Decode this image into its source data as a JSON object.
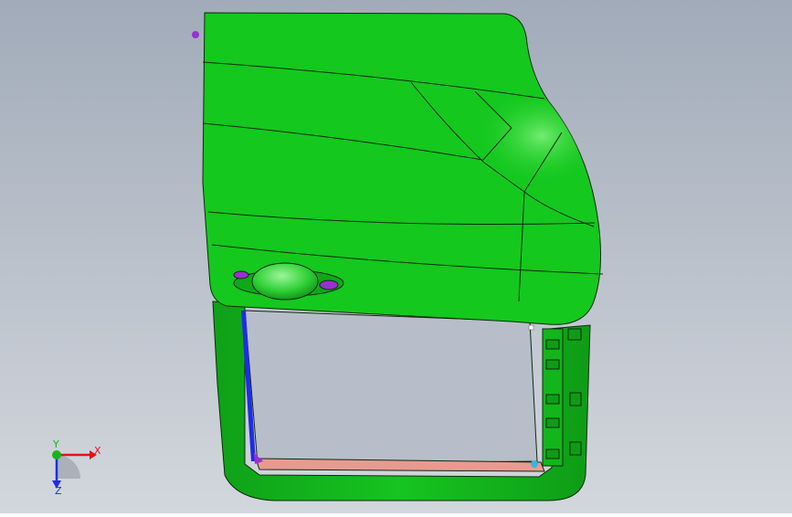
{
  "viewport": {
    "background_top": "#a1abb9",
    "background_bottom": "#d2d6dc",
    "part_color": "#14c81e",
    "part_edge_color": "#0d2a0d",
    "trim_blue": "#1f2ce6",
    "trim_pink": "#e89a90",
    "accent_purple": "#9a2fd2"
  },
  "triad": {
    "x_label": "X",
    "y_label": "Y",
    "z_label": "Z",
    "x_color": "#e0141a",
    "y_color": "#18b418",
    "z_color": "#1f2ce6",
    "icons": [
      "x-axis-arrow-icon",
      "y-axis-arrow-icon",
      "z-axis-arrow-icon"
    ]
  }
}
